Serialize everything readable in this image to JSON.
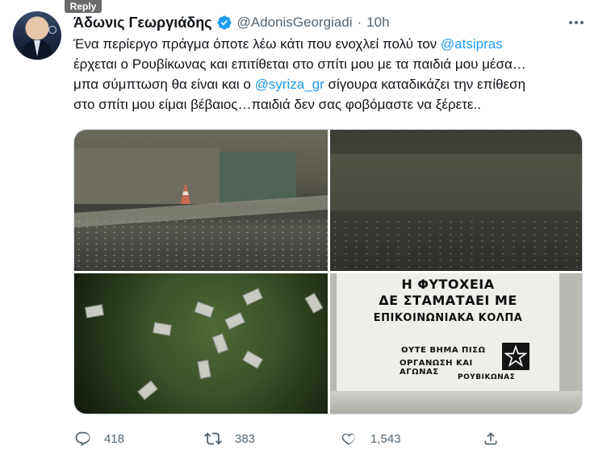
{
  "overlay": {
    "reply_tag": "Reply"
  },
  "tweet": {
    "author_name": "Άδωνις Γεωργιάδης",
    "handle": "@AdonisGeorgiadi",
    "separator": "·",
    "time": "10h",
    "text_lines": [
      [
        "Ένα περίεργο πράγμα όποτε λέω κάτι που ενοχλεί πολύ τον ",
        "@atsipras"
      ],
      [
        "έρχεται ο Ρουβίκωνας και επιτίθεται στο σπίτι μου με τα παιδιά μου μέσα…"
      ],
      [
        "μπα σύμπτωση θα είναι και ο ",
        "@syriza_gr",
        " σίγουρα καταδικάζει την επίθεση"
      ],
      [
        "στο σπίτι μου είμαι βέβαιος…παιδιά δεν σας φοβόμαστε να ξέρετε.."
      ]
    ],
    "mentions": [
      "@atsipras",
      "@syriza_gr"
    ],
    "poster": {
      "line1": "Η ΦΥΤΟΧΕΙΑ",
      "line2": "ΔΕ ΣΤΑΜΑΤΑΕΙ ΜΕ",
      "line3": "ΕΠΙΚΟΙΝΩΝΙΑΚΑ ΚΟΛΠΑ",
      "line4": "ΟΥΤΕ ΒΗΜΑ ΠΙΣΩ",
      "line5": "ΟΡΓΑΝΩΣΗ ΚΑΙ ΑΓΩΝΑΣ",
      "line6": "ΡΟΥΒΙΚΩΝΑΣ"
    },
    "stats": {
      "replies": "418",
      "retweets": "383",
      "likes": "1,543"
    }
  },
  "icons": {
    "verified": "verified-badge-icon",
    "more": "more-options-icon",
    "reply": "reply-bubble-icon",
    "retweet": "retweet-icon",
    "like": "heart-icon",
    "share": "share-upload-icon"
  },
  "colors": {
    "link": "#1d9bf0",
    "text": "#0f1419",
    "muted": "#536471"
  }
}
